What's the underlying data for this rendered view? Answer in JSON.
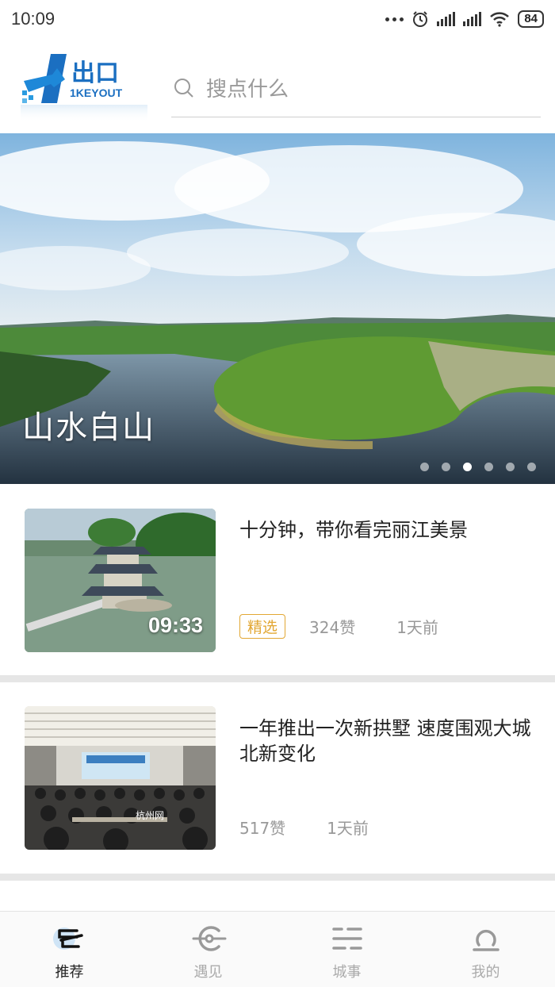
{
  "status_bar": {
    "time": "10:09",
    "battery": "84"
  },
  "header": {
    "logo_text": "出口",
    "logo_sub": "1KEYOUT",
    "search_placeholder": "搜点什么"
  },
  "banner": {
    "title": "山水白山",
    "page_count": 6,
    "active_index": 2
  },
  "feed": [
    {
      "title": "十分钟，带你看完丽江美景",
      "duration": "09:33",
      "tag": "精选",
      "likes": "324赞",
      "time": "1天前"
    },
    {
      "title": "一年推出一次新拱墅 速度围观大城北新变化",
      "likes": "517赞",
      "time": "1天前",
      "thumb_watermark": "杭州网"
    }
  ],
  "bottom_nav": [
    {
      "label": "推荐",
      "icon": "recommend-icon",
      "active": true
    },
    {
      "label": "遇见",
      "icon": "meet-icon",
      "active": false
    },
    {
      "label": "城事",
      "icon": "city-icon",
      "active": false
    },
    {
      "label": "我的",
      "icon": "profile-icon",
      "active": false
    }
  ]
}
